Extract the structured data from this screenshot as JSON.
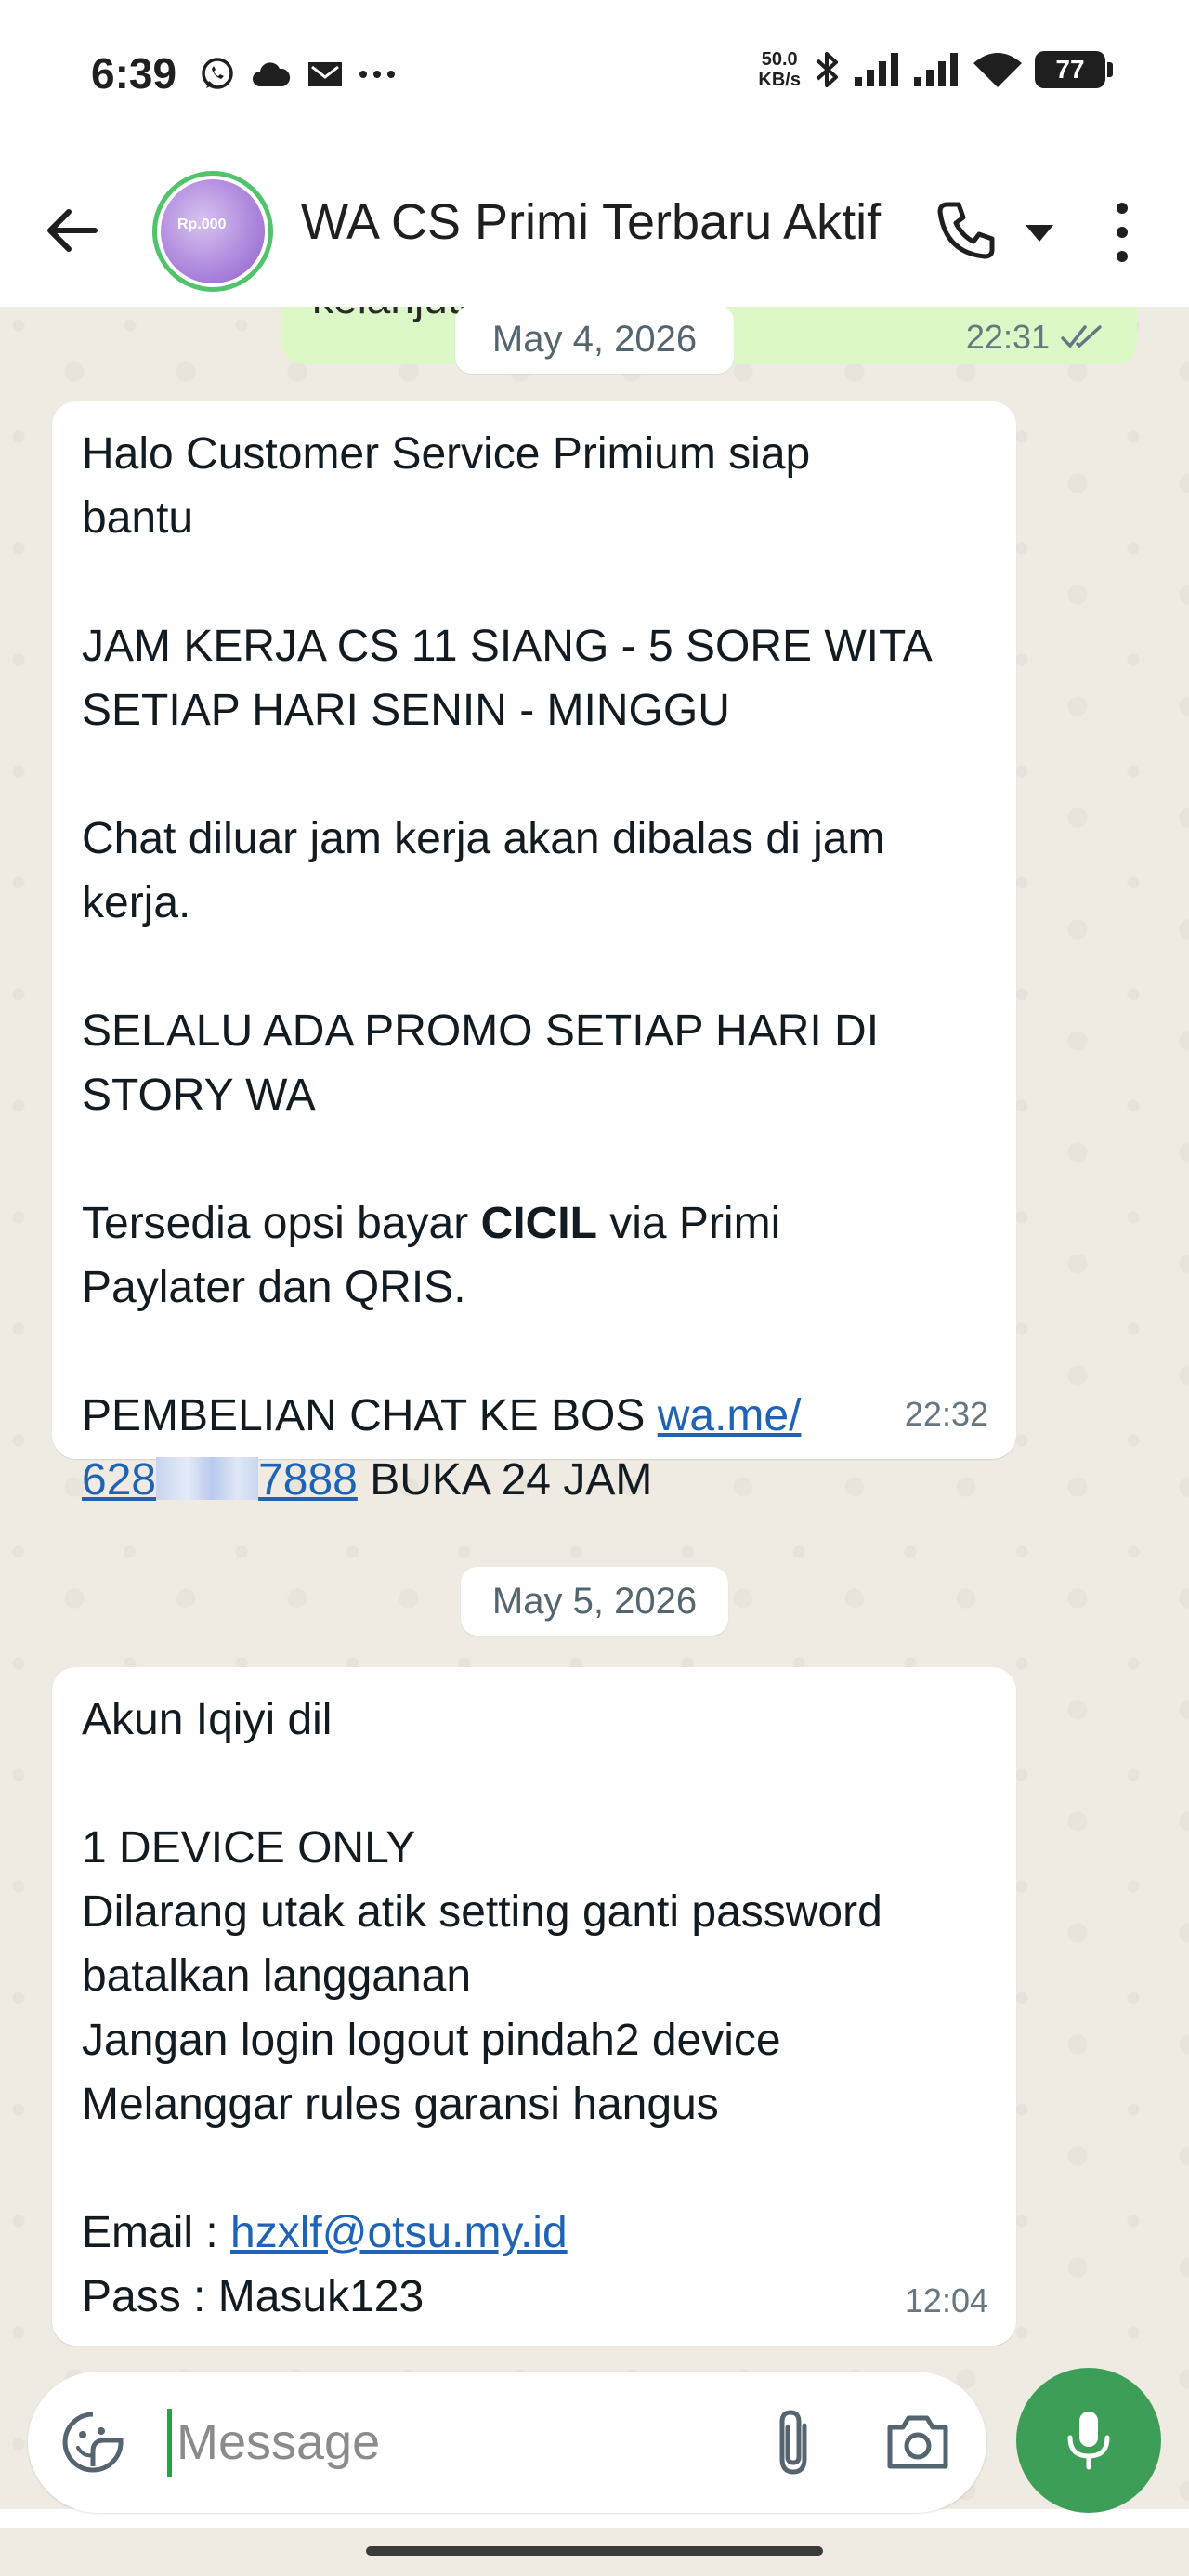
{
  "status_bar": {
    "time": "6:39",
    "net_speed_value": "50.0",
    "net_speed_unit": "KB/s",
    "battery": "77",
    "icons": [
      "whatsapp-icon",
      "cloud-icon",
      "mail-icon",
      "more-icon",
      "bluetooth-icon",
      "signal-icon",
      "signal-icon",
      "wifi-icon",
      "battery-icon"
    ]
  },
  "header": {
    "title": "WA CS Primi Terbaru Aktif",
    "avatar_text": "Rp.000"
  },
  "chat": {
    "previous_message": {
      "partial_text": "kelanjutan ya",
      "time": "22:31"
    },
    "dates": [
      "May 4, 2026",
      "May 5, 2026"
    ],
    "message1": {
      "line1": "Halo Customer Service Primium siap",
      "line2": "bantu",
      "line3": "JAM KERJA CS 11 SIANG - 5 SORE WITA",
      "line4": "SETIAP HARI SENIN - MINGGU",
      "line5": "Chat diluar jam kerja akan dibalas di jam",
      "line6": "kerja.",
      "line7": "SELALU ADA PROMO SETIAP HARI DI",
      "line8": "STORY WA",
      "line9_pre": "Tersedia opsi bayar ",
      "line9_bold": "CICIL",
      "line9_post": " via Primi",
      "line10": "Paylater dan QRIS.",
      "line11_pre": "PEMBELIAN CHAT KE BOS ",
      "link_part1": "wa.me/",
      "link_part2_start": "628",
      "link_part2_end": "7888",
      "line12_post": " BUKA 24 JAM",
      "time": "22:32"
    },
    "message2": {
      "line1": "Akun Iqiyi dil",
      "line2": "1 DEVICE ONLY",
      "line3": "Dilarang utak atik setting ganti password",
      "line4": "batalkan langganan",
      "line5": "Jangan login logout pindah2 device",
      "line6": "Melanggar rules garansi hangus",
      "email_label": "Email : ",
      "email": "hzxlf@otsu.my.id",
      "pass": "Pass : Masuk123",
      "time": "12:04"
    }
  },
  "input": {
    "placeholder": "Message"
  },
  "colors": {
    "chat_bg": "#efeae2",
    "bubble_in": "#ffffff",
    "bubble_out": "#dcf8c6",
    "link": "#1e63b6",
    "mic": "#3d9f57"
  }
}
